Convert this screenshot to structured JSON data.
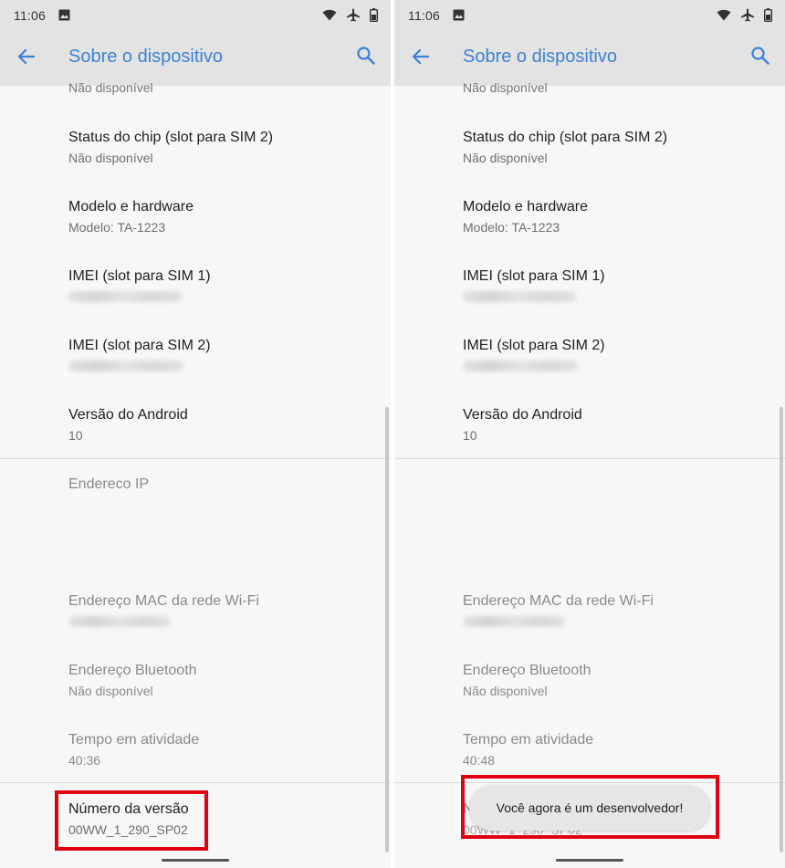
{
  "status": {
    "time": "11:06"
  },
  "appbar": {
    "title": "Sobre o dispositivo"
  },
  "top_partial": "Não disponível",
  "items": [
    {
      "title": "Status do chip (slot para SIM 2)",
      "subtitle": "Não disponível"
    },
    {
      "title": "Modelo e hardware",
      "subtitle": "Modelo: TA-1223"
    },
    {
      "title": "IMEI (slot para SIM 1)",
      "subtitle": ""
    },
    {
      "title": "IMEI (slot para SIM 2)",
      "subtitle": ""
    },
    {
      "title": "Versão do Android",
      "subtitle": "10"
    },
    {
      "title": "Endereco IP",
      "subtitle": ""
    },
    {
      "title": "Endereço MAC da rede Wi-Fi",
      "subtitle": ""
    },
    {
      "title": "Endereço Bluetooth",
      "subtitle": "Não disponível"
    },
    {
      "title": "Tempo em atividade",
      "subtitle": "40:36"
    },
    {
      "title": "Número da versão",
      "subtitle": "00WW_1_290_SP02"
    }
  ],
  "right_uptime": "40:48",
  "toast": {
    "text": "Você agora é um desenvolvedor!"
  },
  "colors": {
    "accent": "#3c82d6",
    "highlight": "#e1000f"
  },
  "icons": [
    "arrow-back-icon",
    "search-icon",
    "wifi-icon",
    "airplane-icon",
    "battery-icon",
    "image-icon"
  ]
}
